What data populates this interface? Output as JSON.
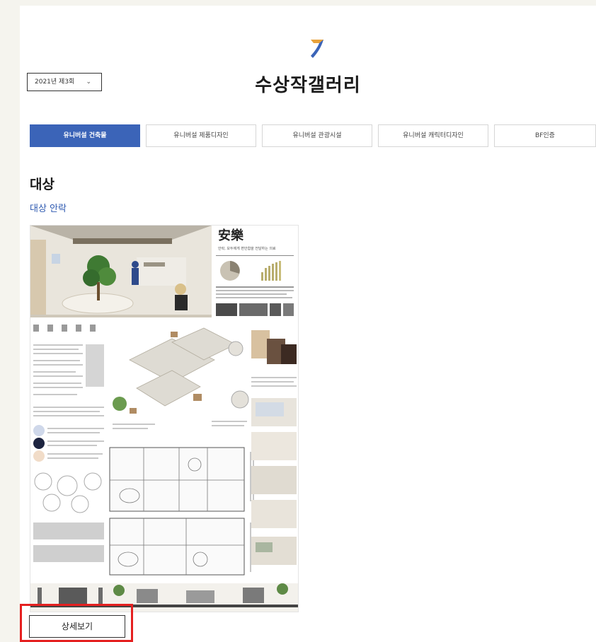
{
  "header": {
    "title": "수상작갤러리",
    "logo_icon": "brand-mark-icon",
    "accent_color": "#3b64b8"
  },
  "year_select": {
    "value": "2021년 제3회",
    "icon": "chevron-down-icon"
  },
  "tabs": [
    {
      "label": "유니버설 건축물",
      "active": true
    },
    {
      "label": "유니버설 제품디자인",
      "active": false
    },
    {
      "label": "유니버설 관광시설",
      "active": false
    },
    {
      "label": "유니버설 캐릭터디자인",
      "active": false
    },
    {
      "label": "BF인증",
      "active": false
    }
  ],
  "award": {
    "rank": "대상",
    "entry_title": "대상 안락",
    "poster": {
      "heading": "安樂",
      "subheading": "안락, 모두에게 편안함을 전달하는 의료"
    }
  },
  "detail_button": {
    "label": "상세보기",
    "highlight_color": "#e52020"
  }
}
